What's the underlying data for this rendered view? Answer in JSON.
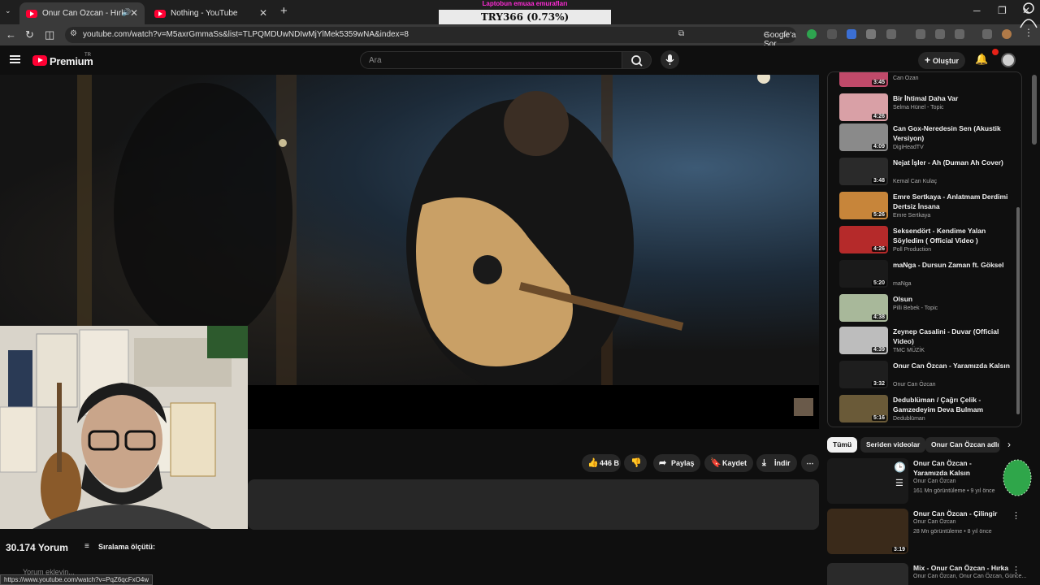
{
  "browser": {
    "tabs": [
      {
        "title": "Onur Can Özcan - Hırka - Y",
        "active": true
      },
      {
        "title": "Nothing - YouTube",
        "active": false
      }
    ],
    "url": "youtube.com/watch?v=M5axrGmmaSs&list=TLPQMDUwNDIwMjYlMek5359wNA&index=8",
    "google_ask": "Google'a Sor",
    "status_url": "https://www.youtube.com/watch?v=PqZ6qcFxO4w"
  },
  "overlay": {
    "top_text": "Laptobun emuaa emurafları",
    "box_text": "TRY366 (0.73%)"
  },
  "header": {
    "brand": "Premium",
    "region": "TR",
    "search_placeholder": "Ara",
    "create_label": "Oluştur"
  },
  "actions": {
    "like_count": "446 B",
    "share": "Paylaş",
    "save": "Kaydet",
    "download": "İndir"
  },
  "comments": {
    "count": "30.174 Yorum",
    "sort_label": "Sıralama ölçütü:",
    "add_placeholder": "Yorum ekleyin..."
  },
  "playlist": [
    {
      "title": "",
      "channel": "Can Ozan",
      "duration": "3:45",
      "color": "#c04a6a"
    },
    {
      "title": "Bir İhtimal Daha Var",
      "channel": "Selma Hünel - Topic",
      "duration": "4:26",
      "color": "#d9a0a6"
    },
    {
      "title": "Can Gox-Neredesin Sen (Akustik Versiyon)",
      "channel": "DigiHeadTV",
      "duration": "4:09",
      "color": "#8a8a8a"
    },
    {
      "title": "Nejat İşler - Ah (Duman Ah Cover)",
      "channel": "Kemal Can Kulaç",
      "duration": "3:48",
      "color": "#2a2a2a"
    },
    {
      "title": "Emre Sertkaya - Anlatmam Derdimi Dertsiz İnsana",
      "channel": "Emre Sertkaya",
      "duration": "5:26",
      "color": "#c7853a"
    },
    {
      "title": "Seksendört - Kendime Yalan Söyledim ( Official Video )",
      "channel": "Poll Production",
      "duration": "4:26",
      "color": "#b52a2a"
    },
    {
      "title": "maNga - Dursun Zaman ft. Göksel",
      "channel": "maNga",
      "duration": "5:20",
      "color": "#1a1a1a"
    },
    {
      "title": "Olsun",
      "channel": "Pilli Bebek - Topic",
      "duration": "4:38",
      "color": "#a8b89a"
    },
    {
      "title": "Zeynep Casalini - Duvar (Official Video)",
      "channel": "TMC MÜZİK",
      "duration": "4:39",
      "color": "#bdbdbd"
    },
    {
      "title": "Onur Can Özcan - Yaramızda Kalsın",
      "channel": "Onur Can Özcan",
      "duration": "3:32",
      "color": "#1e1e1e"
    },
    {
      "title": "Dedublüman / Çağrı Çelik - Gamzedeyim Deva Bulmam",
      "channel": "Dedublüman",
      "duration": "5:16",
      "color": "#6a5a38"
    }
  ],
  "chips": [
    {
      "label": "Tümü",
      "active": true
    },
    {
      "label": "Seriden videolar",
      "active": false
    },
    {
      "label": "Onur Can Özcan adlı",
      "active": false
    }
  ],
  "recommendations": [
    {
      "title": "Onur Can Özcan - Yaramızda Kalsın",
      "channel": "Onur Can Özcan",
      "meta": "161 Mn görüntüleme • 9 yıl önce",
      "duration": "",
      "color": "#1a1a1a"
    },
    {
      "title": "Onur Can Özcan - Çilingir",
      "channel": "Onur Can Özcan",
      "meta": "28 Mn görüntüleme • 8 yıl önce",
      "duration": "3:19",
      "color": "#3a2a1a"
    },
    {
      "title": "Mix - Onur Can Özcan - Hırka",
      "channel": "Onur Can Özcan, Onur Can Özcan, Günce...",
      "meta": "",
      "duration": "",
      "color": "#2a2a2a"
    }
  ]
}
